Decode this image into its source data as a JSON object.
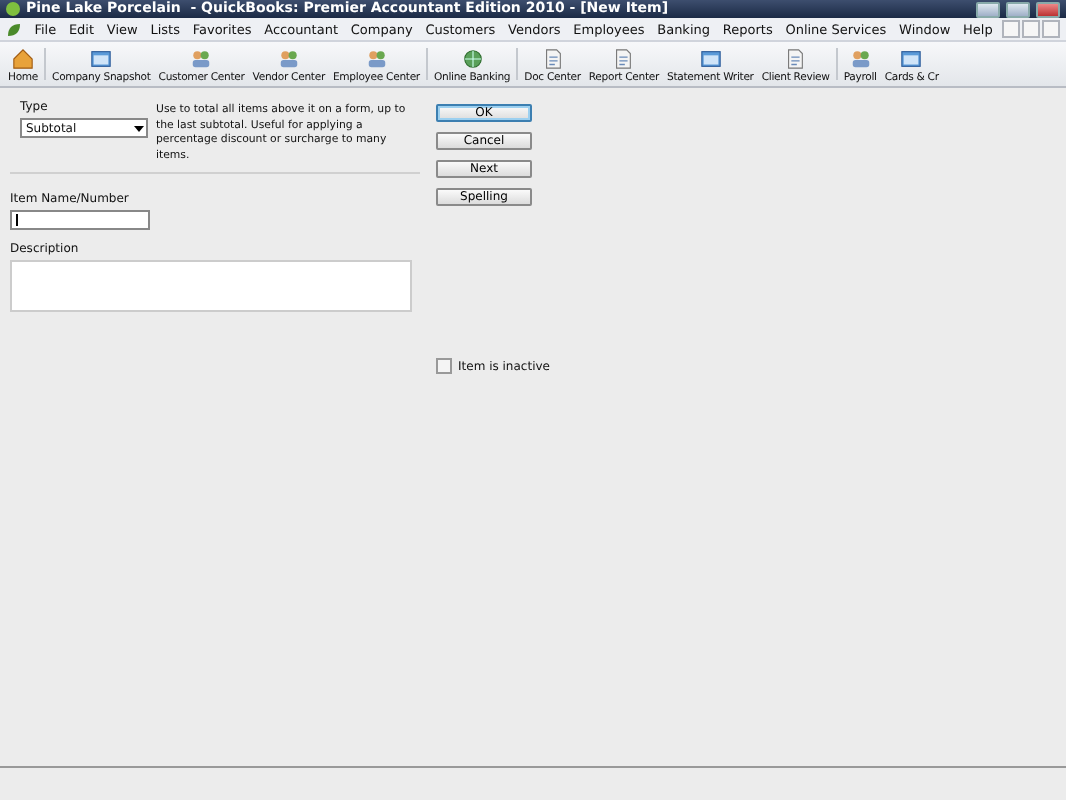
{
  "window": {
    "title": "Pine Lake Porcelain  - QuickBooks: Premier Accountant Edition 2010 - [New Item]"
  },
  "menu_bar": {
    "items": [
      "File",
      "Edit",
      "View",
      "Lists",
      "Favorites",
      "Accountant",
      "Company",
      "Customers",
      "Vendors",
      "Employees",
      "Banking",
      "Reports",
      "Online Services",
      "Window",
      "Help"
    ]
  },
  "toolbar": {
    "buttons": [
      {
        "label": "Home",
        "kind": "house"
      },
      {
        "label": "Company Snapshot",
        "kind": "window"
      },
      {
        "label": "Customer Center",
        "kind": "people"
      },
      {
        "label": "Vendor Center",
        "kind": "people"
      },
      {
        "label": "Employee Center",
        "kind": "people"
      },
      {
        "label": "Online Banking",
        "kind": "globe"
      },
      {
        "label": "Doc Center",
        "kind": "document"
      },
      {
        "label": "Report Center",
        "kind": "document"
      },
      {
        "label": "Statement Writer",
        "kind": "window"
      },
      {
        "label": "Client Review",
        "kind": "document"
      },
      {
        "label": "Payroll",
        "kind": "people"
      },
      {
        "label": "Cards & Cr",
        "kind": "window"
      }
    ]
  },
  "form": {
    "type_label": "Type",
    "type_value": "Subtotal",
    "type_description": "Use to total all items above it on a form, up to the last subtotal. Useful for applying a percentage discount or surcharge to many items.",
    "name_label": "Item Name/Number",
    "description_label": "Description",
    "inactive": {
      "label": "Item is inactive",
      "checked": false
    },
    "buttons": [
      {
        "label": "OK",
        "default": true
      },
      {
        "label": "Cancel",
        "default": false
      },
      {
        "label": "Next",
        "default": false
      },
      {
        "label": "Spelling",
        "default": false
      }
    ]
  }
}
